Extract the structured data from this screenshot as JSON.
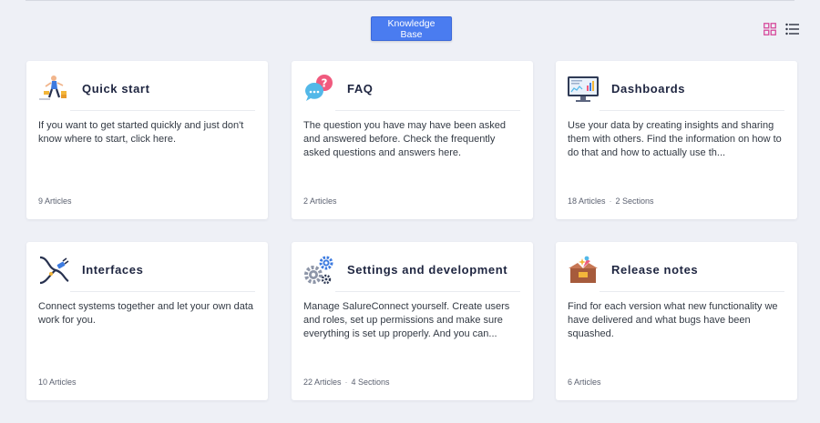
{
  "header": {
    "kb_button_label": "Knowledge Base"
  },
  "view_toggle": {
    "grid_icon": "grid-view-icon",
    "list_icon": "list-view-icon",
    "active_color": "#d64a9c"
  },
  "colors": {
    "accent": "#4a7cf0",
    "card_bg": "#ffffff",
    "page_bg": "#eef0f6"
  },
  "cards": [
    {
      "icon": "person-running-icon",
      "title": "Quick start",
      "description": "If you want to get started quickly and just don't know where to start, click here.",
      "articles": "9 Articles",
      "sections": ""
    },
    {
      "icon": "faq-chat-bubbles-icon",
      "title": "FAQ",
      "description": "The question you have may have been asked and answered before. Check the frequently asked questions and answers here.",
      "articles": "2 Articles",
      "sections": ""
    },
    {
      "icon": "dashboard-monitor-icon",
      "title": "Dashboards",
      "description": "Use your data by creating insights and sharing them with others. Find the information on how to do that and how to actually use th...",
      "articles": "18 Articles",
      "sections": "2 Sections"
    },
    {
      "icon": "interface-plug-icon",
      "title": "Interfaces",
      "description": "Connect systems together and let your own data work for you.",
      "articles": "10 Articles",
      "sections": ""
    },
    {
      "icon": "gears-icon",
      "title": "Settings and development",
      "description": "Manage SalureConnect yourself. Create users and roles, set up permissions and make sure everything is set up properly. And you can...",
      "articles": "22 Articles",
      "sections": "4 Sections"
    },
    {
      "icon": "release-box-icon",
      "title": "Release notes",
      "description": "Find for each version what new functionality we have delivered and what bugs have been squashed.",
      "articles": "6 Articles",
      "sections": ""
    }
  ]
}
